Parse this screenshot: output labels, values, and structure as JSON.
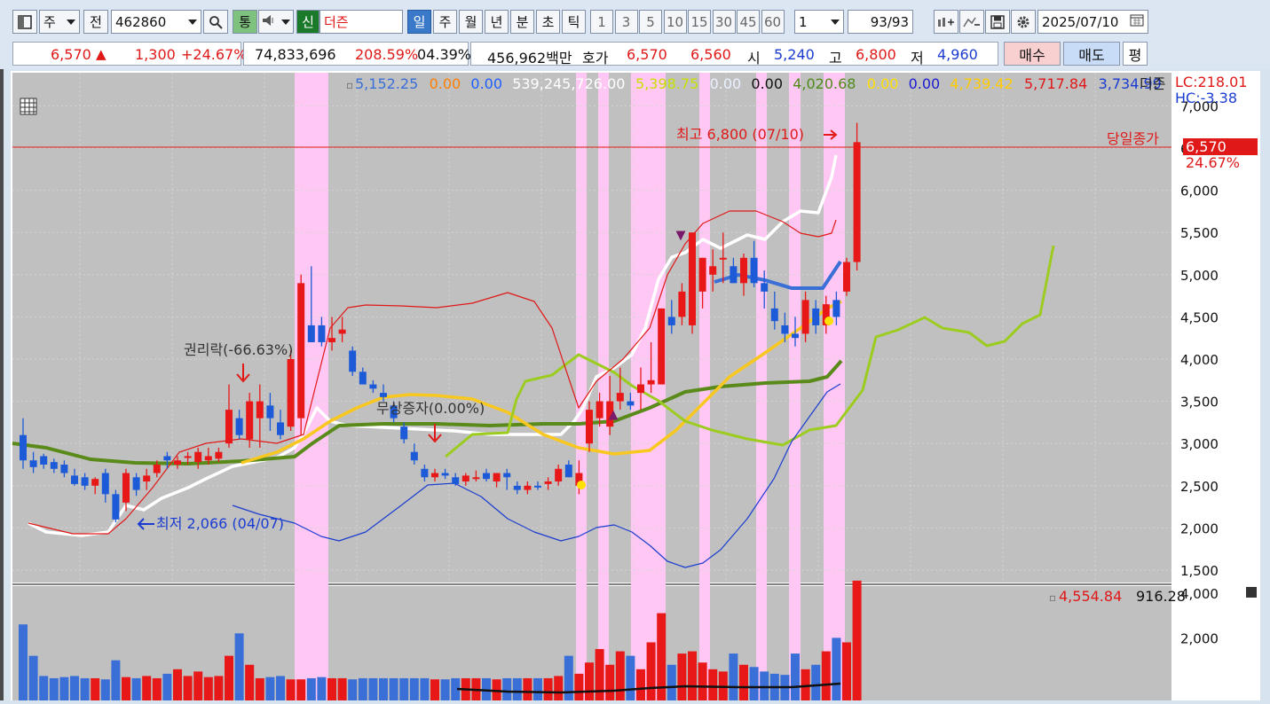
{
  "toolbar": {
    "market": "주",
    "jeon": "전",
    "code": "462860",
    "tong": "통",
    "sin": "신",
    "deojeun": "더즌",
    "periods": [
      "일",
      "주",
      "월",
      "년",
      "분",
      "초",
      "틱"
    ],
    "active_period": "일",
    "intervals": [
      "1",
      "3",
      "5",
      "10",
      "15",
      "30",
      "45",
      "60"
    ],
    "multiplier": "1",
    "count": "93",
    "total": "/93",
    "date": "2025/07/10"
  },
  "quote": {
    "price": "6,570",
    "arrow": "▲",
    "change": "1,300",
    "change_pct": "+24.67%",
    "volume": "74,833,696",
    "vol_ratio": "208.59%",
    "turnover": "04.39%",
    "amount": "456,962백만",
    "hoga_label": "호가",
    "ask": "6,570",
    "bid": "6,560",
    "open_label": "시",
    "open": "5,240",
    "high_label": "고",
    "high": "6,800",
    "low_label": "저",
    "low": "4,960",
    "buy": "매수",
    "sell": "매도",
    "eval": "평"
  },
  "legend": {
    "items": [
      {
        "text": "5,152.25",
        "color": "#3a6fd8"
      },
      {
        "text": "0.00",
        "color": "#ff7f00"
      },
      {
        "text": "0.00",
        "color": "#1c5fff"
      },
      {
        "text": "539,245,726.00",
        "color": "#ffffff"
      },
      {
        "text": "5,398.75",
        "color": "#c8e000"
      },
      {
        "text": "0.00",
        "color": "#eaf0ff"
      },
      {
        "text": "0.00",
        "color": "#111111"
      },
      {
        "text": "4,020.68",
        "color": "#4e8b1a"
      },
      {
        "text": "0.00",
        "color": "#ffe000"
      },
      {
        "text": "0.00",
        "color": "#1a1ad0"
      },
      {
        "text": "4,739.42",
        "color": "#ffcc00"
      },
      {
        "text": "5,717.84",
        "color": "#e01818"
      },
      {
        "text": "3,734.99",
        "color": "#1a3cd0"
      }
    ],
    "name": "더즌",
    "lc": "LC:218.01",
    "hc": "HC:-3.38"
  },
  "annotations": {
    "high": "최고 6,800 (07/10)",
    "low": "최저 2,066 (04/07)",
    "rights": "권리락(-66.63%)",
    "bonus": "무상증자(0.00%)",
    "close_label": "당일종가",
    "close_price": "6,570",
    "close_pct": "24.67%"
  },
  "volume_legend": {
    "v1": "4,554.84",
    "v2": "916.28"
  },
  "chart_data": {
    "type": "candlestick",
    "price_axis": {
      "ticks": [
        7000,
        6500,
        6000,
        5500,
        5000,
        4500,
        4000,
        3500,
        3000,
        2500,
        2000,
        1500
      ],
      "tick_labels": [
        "7,000",
        "6,500",
        "6,000",
        "5,500",
        "5,000",
        "4,500",
        "4,000",
        "3,500",
        "3,000",
        "2,500",
        "2,000",
        "1,500"
      ]
    },
    "volume_axis": {
      "ticks": [
        4000,
        2000
      ],
      "tick_labels": [
        "4,000",
        "2,000"
      ]
    },
    "last_close": 6570,
    "high": {
      "value": 6800,
      "date": "07/10"
    },
    "low": {
      "value": 2066,
      "date": "04/07"
    },
    "candles": [
      [
        3100,
        3300,
        2700,
        2800
      ],
      [
        2800,
        2900,
        2650,
        2720
      ],
      [
        2850,
        2880,
        2700,
        2750
      ],
      [
        2780,
        2820,
        2650,
        2700
      ],
      [
        2750,
        2800,
        2600,
        2650
      ],
      [
        2620,
        2700,
        2500,
        2520
      ],
      [
        2600,
        2650,
        2450,
        2500
      ],
      [
        2500,
        2600,
        2400,
        2580
      ],
      [
        2650,
        2700,
        2300,
        2400
      ],
      [
        2400,
        2450,
        2066,
        2100
      ],
      [
        2300,
        2700,
        2200,
        2650
      ],
      [
        2600,
        2650,
        2380,
        2450
      ],
      [
        2550,
        2700,
        2450,
        2620
      ],
      [
        2650,
        2800,
        2600,
        2750
      ],
      [
        2850,
        2900,
        2700,
        2800
      ],
      [
        2750,
        2850,
        2700,
        2800
      ],
      [
        2830,
        2900,
        2750,
        2850
      ],
      [
        2780,
        2950,
        2700,
        2900
      ],
      [
        2800,
        2950,
        2750,
        2850
      ],
      [
        2820,
        2950,
        2780,
        2900
      ],
      [
        3000,
        3700,
        2950,
        3400
      ],
      [
        3300,
        3400,
        3050,
        3100
      ],
      [
        3050,
        3600,
        2950,
        3500
      ],
      [
        3300,
        3700,
        2950,
        3500
      ],
      [
        3450,
        3600,
        3150,
        3300
      ],
      [
        3250,
        3400,
        3050,
        3100
      ],
      [
        3200,
        4100,
        3150,
        4000
      ],
      [
        3300,
        5000,
        3100,
        4900
      ],
      [
        4400,
        5100,
        4200,
        4200
      ],
      [
        4400,
        4500,
        4150,
        4200
      ],
      [
        4200,
        4500,
        4100,
        4250
      ],
      [
        4300,
        4500,
        4200,
        4350
      ],
      [
        4100,
        4150,
        3800,
        3850
      ],
      [
        3850,
        3900,
        3700,
        3700
      ],
      [
        3700,
        3750,
        3600,
        3650
      ],
      [
        3600,
        3700,
        3500,
        3550
      ],
      [
        3450,
        3500,
        3250,
        3300
      ],
      [
        3200,
        3250,
        3000,
        3050
      ],
      [
        2900,
        3000,
        2750,
        2800
      ],
      [
        2700,
        2750,
        2550,
        2600
      ],
      [
        2600,
        2700,
        2550,
        2650
      ],
      [
        2650,
        2700,
        2580,
        2620
      ],
      [
        2600,
        2650,
        2500,
        2520
      ],
      [
        2550,
        2650,
        2500,
        2620
      ],
      [
        2600,
        2680,
        2550,
        2600
      ],
      [
        2650,
        2700,
        2550,
        2580
      ],
      [
        2550,
        2650,
        2480,
        2650
      ],
      [
        2650,
        2700,
        2450,
        2600
      ],
      [
        2500,
        2550,
        2400,
        2450
      ],
      [
        2450,
        2550,
        2400,
        2500
      ],
      [
        2500,
        2550,
        2450,
        2480
      ],
      [
        2520,
        2600,
        2450,
        2550
      ],
      [
        2550,
        2750,
        2500,
        2700
      ],
      [
        2750,
        2800,
        2600,
        2600
      ],
      [
        2500,
        2800,
        2400,
        2650
      ],
      [
        3000,
        3500,
        2900,
        3400
      ],
      [
        3300,
        3600,
        3200,
        3500
      ],
      [
        3200,
        3800,
        3100,
        3500
      ],
      [
        3500,
        3900,
        3400,
        3600
      ],
      [
        3500,
        3600,
        3400,
        3450
      ],
      [
        3600,
        3900,
        3400,
        3700
      ],
      [
        3700,
        4200,
        3600,
        3750
      ],
      [
        3700,
        4600,
        3700,
        4600
      ],
      [
        4500,
        4700,
        4300,
        4400
      ],
      [
        4500,
        4900,
        4400,
        4800
      ],
      [
        4400,
        5500,
        4300,
        5500
      ],
      [
        4800,
        5200,
        4600,
        5200
      ],
      [
        5000,
        5300,
        4800,
        5100
      ],
      [
        5200,
        5500,
        4900,
        5200
      ],
      [
        5100,
        5200,
        4900,
        4900
      ],
      [
        4900,
        5250,
        4750,
        5200
      ],
      [
        5200,
        5400,
        4850,
        4900
      ],
      [
        4900,
        5050,
        4600,
        4800
      ],
      [
        4600,
        4800,
        4350,
        4450
      ],
      [
        4400,
        4550,
        4200,
        4300
      ],
      [
        4300,
        4500,
        4150,
        4250
      ],
      [
        4300,
        4800,
        4200,
        4700
      ],
      [
        4600,
        4700,
        4300,
        4400
      ],
      [
        4400,
        4750,
        4300,
        4650
      ],
      [
        4700,
        4800,
        4400,
        4500
      ],
      [
        4800,
        5200,
        4750,
        5150
      ],
      [
        5150,
        6800,
        5050,
        6570
      ]
    ],
    "volume": [
      2600,
      1200,
      300,
      200,
      250,
      300,
      200,
      200,
      150,
      1000,
      250,
      200,
      300,
      200,
      400,
      600,
      300,
      500,
      250,
      300,
      1200,
      2200,
      800,
      200,
      250,
      300,
      150,
      150,
      200,
      250,
      200,
      200,
      150,
      200,
      200,
      200,
      200,
      200,
      200,
      200,
      150,
      150,
      200,
      200,
      200,
      200,
      150,
      200,
      200,
      200,
      200,
      200,
      300,
      1200,
      400,
      900,
      1500,
      800,
      1400,
      1200,
      600,
      1800,
      3100,
      800,
      1300,
      1400,
      900,
      600,
      500,
      1300,
      800,
      700,
      500,
      400,
      350,
      1300,
      600,
      800,
      1400,
      2000,
      1800,
      4550
    ]
  }
}
